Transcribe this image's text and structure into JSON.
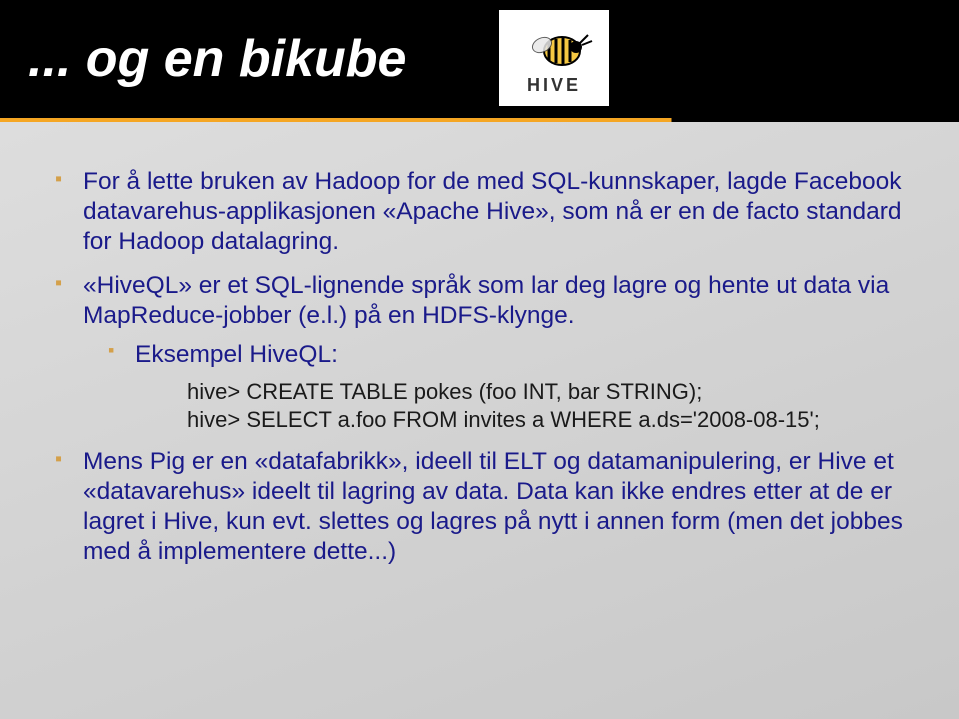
{
  "header": {
    "title": "... og en bikube",
    "logo_text": "HIVE"
  },
  "bullets": [
    {
      "text": "For å lette bruken av Hadoop for de med SQL-kunnskaper, lagde Facebook datavarehus-applikasjonen «Apache Hive», som nå er en de facto standard for Hadoop datalagring."
    },
    {
      "text": "«HiveQL» er et SQL-lignende språk som lar deg lagre og hente ut data via MapReduce-jobber (e.l.) på en HDFS-klynge.",
      "sub": {
        "text": "Eksempel HiveQL:",
        "code": [
          "hive> CREATE TABLE pokes (foo INT, bar STRING);",
          "hive> SELECT a.foo FROM invites a WHERE a.ds='2008-08-15';"
        ]
      }
    },
    {
      "text": "Mens Pig er en «datafabrikk», ideell til ELT og datamanipulering, er Hive et «datavarehus» ideelt til lagring av data. Data kan ikke endres etter at de er lagret i Hive, kun evt. slettes og lagres på nytt i annen form (men det jobbes med å implementere dette...)"
    }
  ]
}
